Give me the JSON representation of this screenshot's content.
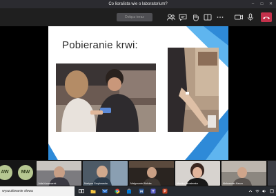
{
  "window": {
    "title": "Co lioralista wie o laboratorium?"
  },
  "toolbar": {
    "join_label": "Dołącz teraz",
    "icons": [
      "people-icon",
      "chat-icon",
      "raise-hand-icon",
      "rooms-icon",
      "more-icon",
      "camera-icon",
      "mic-icon",
      "share-icon",
      "leave-call-icon"
    ],
    "leave_color": "#c4314b"
  },
  "slide": {
    "title": "Pobieranie krwi:",
    "accent_color": "#2e8ad8"
  },
  "participants": {
    "avatars": [
      {
        "initials": "AW"
      },
      {
        "initials": "MW"
      }
    ],
    "tiles": [
      {
        "name": "Julia Kaczmarek"
      },
      {
        "name": "Martyna Grzybowska"
      },
      {
        "name": "Małgorzata Wolska"
      },
      {
        "name": "Monika Jarosiewicz"
      },
      {
        "name": "Aleksander Kaczo"
      }
    ]
  },
  "taskbar": {
    "search_placeholder": "wyszukiwanie słowa",
    "apps": [
      "task-view-icon",
      "file-explorer-icon",
      "mail-icon",
      "chrome-icon",
      "store-icon",
      "word-icon",
      "teams-icon",
      "powerpoint-icon"
    ]
  }
}
